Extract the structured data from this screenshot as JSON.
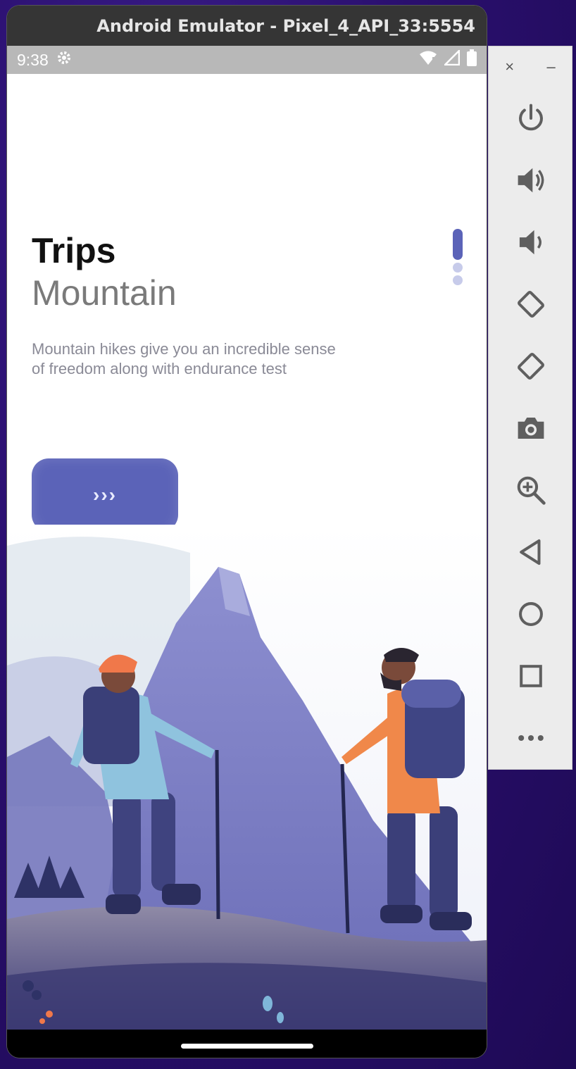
{
  "window": {
    "title": "Android Emulator - Pixel_4_API_33:5554"
  },
  "status_bar": {
    "time": "9:38",
    "icons": [
      "gear-icon",
      "wifi-icon",
      "signal-icon",
      "battery-icon"
    ]
  },
  "app": {
    "title": "Trips",
    "subtitle": "Mountain",
    "description": "Mountain hikes give you an incredible sense of freedom along with endurance test",
    "next_button_label": "›››",
    "page_indicator": {
      "total": 3,
      "active": 1
    },
    "accent_color": "#5b63b8"
  },
  "side_panel": {
    "close_label": "×",
    "minimize_label": "–",
    "buttons": [
      "power",
      "volume-up",
      "volume-down",
      "rotate-left",
      "rotate-right",
      "screenshot",
      "zoom",
      "back",
      "home",
      "overview",
      "more"
    ]
  }
}
